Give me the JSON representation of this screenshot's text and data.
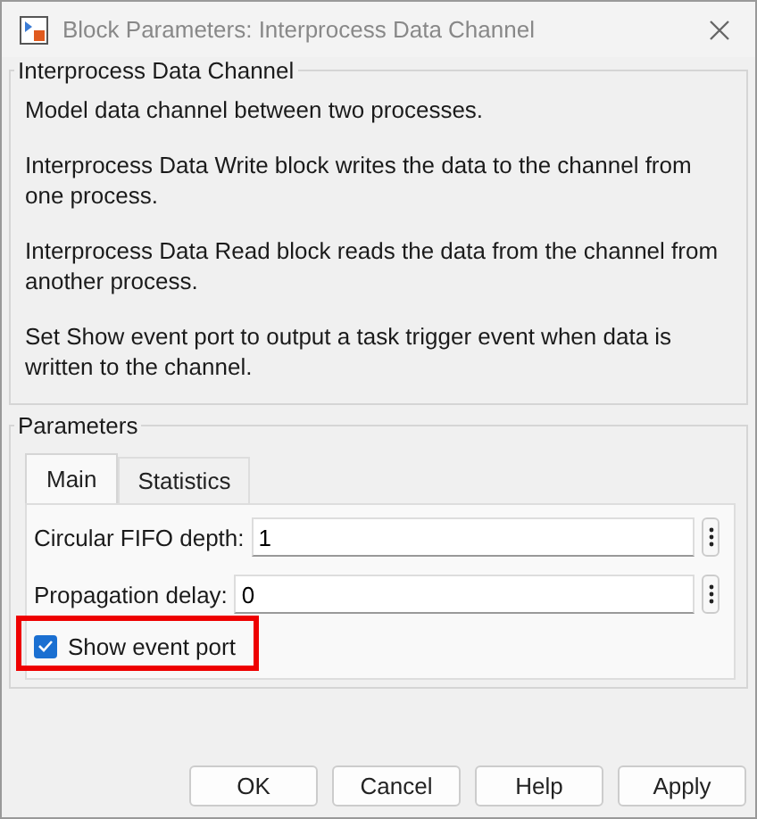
{
  "window": {
    "title": "Block Parameters: Interprocess Data Channel"
  },
  "description": {
    "title": "Interprocess Data Channel",
    "paragraphs": [
      "Model data channel between two processes.",
      "Interprocess Data Write block writes the data to the channel from one process.",
      "Interprocess Data Read block reads the data from the channel from another process.",
      "Set Show event port to output a task trigger event when data is written to the channel."
    ]
  },
  "parameters": {
    "title": "Parameters",
    "tabs": [
      {
        "label": "Main",
        "selected": true
      },
      {
        "label": "Statistics",
        "selected": false
      }
    ],
    "fields": [
      {
        "label": "Circular FIFO depth:",
        "value": "1"
      },
      {
        "label": "Propagation delay:",
        "value": "0"
      }
    ],
    "checkbox": {
      "label": "Show event port",
      "checked": true,
      "highlighted": true
    }
  },
  "buttons": [
    "OK",
    "Cancel",
    "Help",
    "Apply"
  ]
}
